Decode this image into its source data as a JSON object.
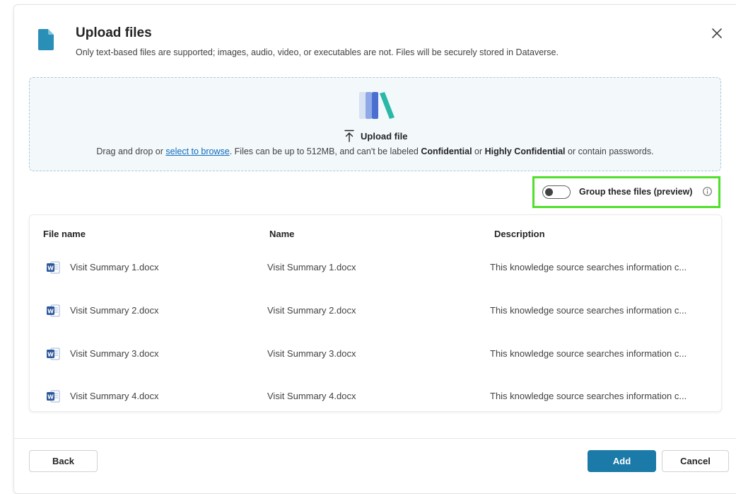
{
  "dialog": {
    "title": "Upload files",
    "subtitle": "Only text-based files are supported; images, audio, video, or executables are not. Files will be securely stored in Dataverse."
  },
  "dropzone": {
    "upload_label": "Upload file",
    "drag_prefix": "Drag and drop or ",
    "browse_link": "select to browse",
    "drag_middle": ". Files can be up to 512MB, and can't be labeled ",
    "confidential": "Confidential",
    "or_text": " or ",
    "highly_confidential": "Highly Confidential",
    "drag_suffix": " or contain passwords."
  },
  "group_toggle": {
    "label": "Group these files (preview)",
    "checked": false,
    "highlight_color": "#4ee02a"
  },
  "table": {
    "columns": [
      "File name",
      "Name",
      "Description"
    ],
    "rows": [
      {
        "file_name": "Visit Summary 1.docx",
        "name": "Visit Summary 1.docx",
        "description": "This knowledge source searches information c..."
      },
      {
        "file_name": "Visit Summary 2.docx",
        "name": "Visit Summary 2.docx",
        "description": "This knowledge source searches information c..."
      },
      {
        "file_name": "Visit Summary 3.docx",
        "name": "Visit Summary 3.docx",
        "description": "This knowledge source searches information c..."
      },
      {
        "file_name": "Visit Summary 4.docx",
        "name": "Visit Summary 4.docx",
        "description": "This knowledge source searches information c..."
      }
    ],
    "file_icon": "word-document-icon"
  },
  "footer": {
    "back_label": "Back",
    "add_label": "Add",
    "cancel_label": "Cancel"
  },
  "colors": {
    "accent": "#1b7aa8",
    "link": "#0f6cbd",
    "dropzone_bg": "#f3f8fb",
    "dropzone_border": "#a9c9de"
  },
  "icons": {
    "header": "document-icon",
    "close": "close-icon",
    "dropzone": "books-icon",
    "upload": "upload-arrow-icon",
    "info": "info-icon"
  }
}
